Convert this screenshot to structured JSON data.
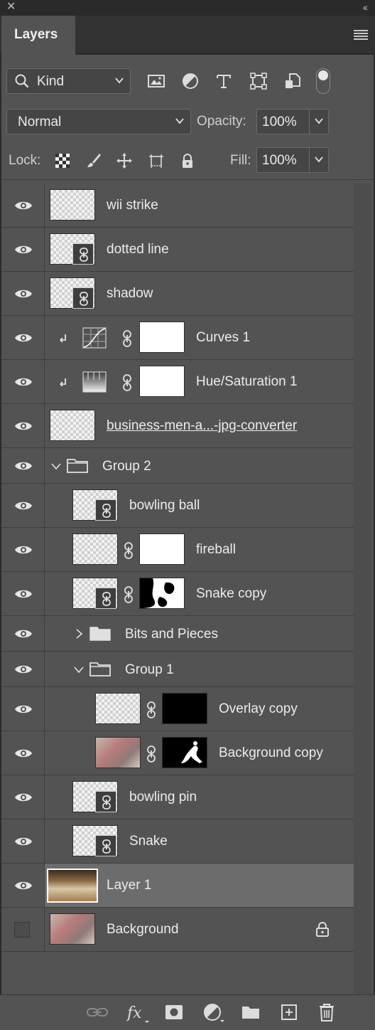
{
  "panel": {
    "tab_label": "Layers",
    "close_glyph": "✕",
    "collapse_glyph": "‹‹"
  },
  "filter": {
    "kind_label": "Kind",
    "filter_icons": [
      "image-filter-icon",
      "adjustment-filter-icon",
      "type-filter-icon",
      "shape-filter-icon",
      "smart-object-filter-icon"
    ]
  },
  "blend": {
    "mode": "Normal",
    "opacity_label": "Opacity:",
    "opacity_value": "100%"
  },
  "lock": {
    "label": "Lock:",
    "fill_label": "Fill:",
    "fill_value": "100%"
  },
  "layers": [
    {
      "name": "wii strike"
    },
    {
      "name": "dotted line"
    },
    {
      "name": "shadow"
    },
    {
      "name": "Curves 1"
    },
    {
      "name": "Hue/Saturation 1"
    },
    {
      "name": "business-men-a...-jpg-converter"
    },
    {
      "name": "Group 2"
    },
    {
      "name": "bowling ball"
    },
    {
      "name": "fireball"
    },
    {
      "name": "Snake copy"
    },
    {
      "name": "Bits and Pieces"
    },
    {
      "name": "Group 1"
    },
    {
      "name": "Overlay copy"
    },
    {
      "name": "Background copy"
    },
    {
      "name": "bowling pin"
    },
    {
      "name": "Snake"
    },
    {
      "name": "Layer 1"
    },
    {
      "name": "Background"
    }
  ],
  "colors": {
    "panel_bg": "#535353",
    "selected_row": "#6c6c6c",
    "chrome_dark": "#323232"
  }
}
